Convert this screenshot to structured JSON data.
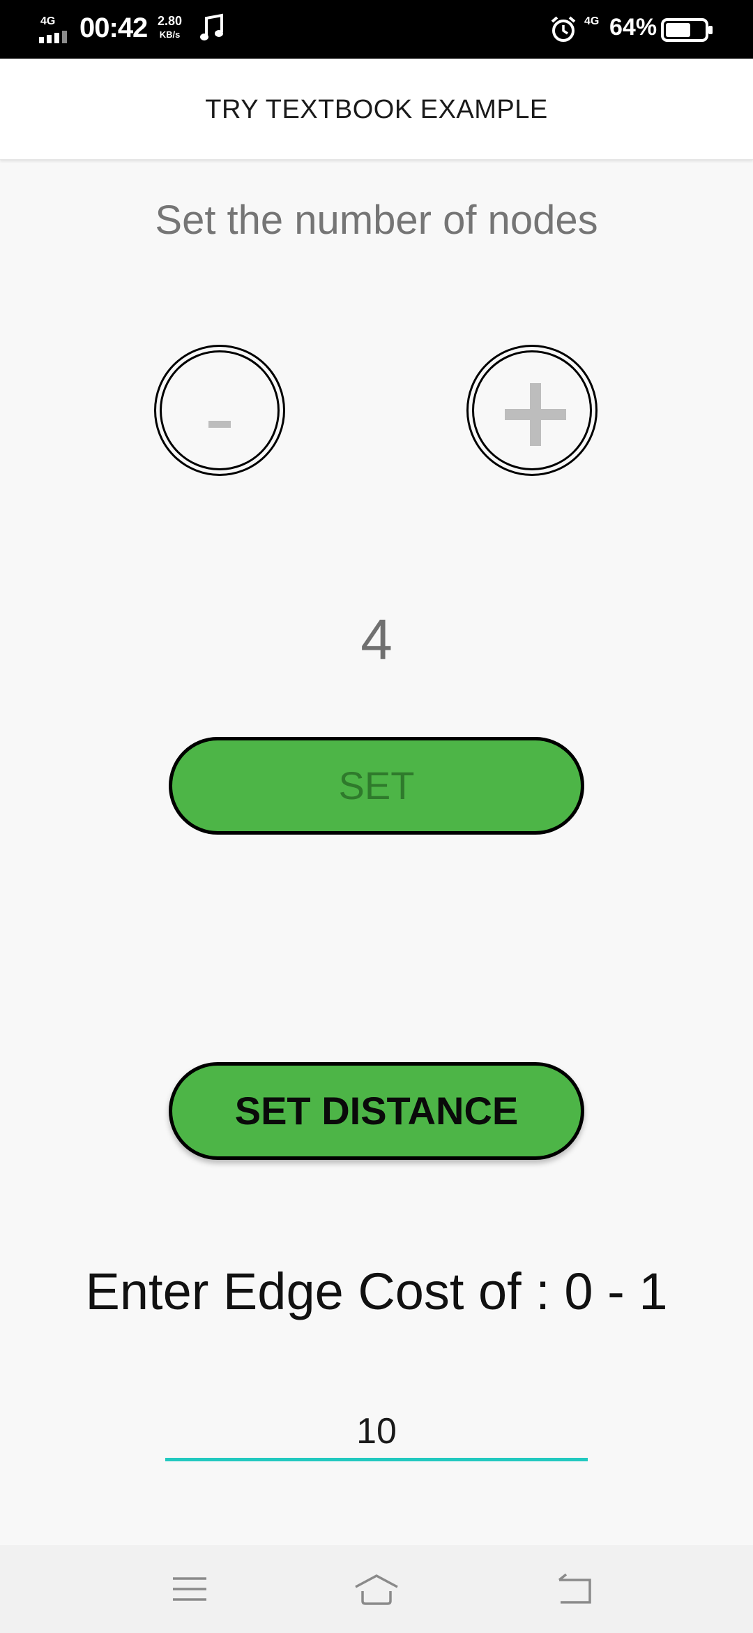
{
  "status_bar": {
    "network_label": "4G",
    "time": "00:42",
    "speed_value": "2.80",
    "speed_unit": "KB/s",
    "secondary_network": "4G",
    "battery_percent": "64%",
    "battery_level": 0.64,
    "icons": [
      "signal-icon",
      "music-note-icon",
      "alarm-icon",
      "battery-icon"
    ]
  },
  "app_bar": {
    "title": "TRY TEXTBOOK EXAMPLE"
  },
  "nodes": {
    "heading": "Set the number of nodes",
    "decrement_label": "-",
    "increment_label": "+",
    "count": "4",
    "set_label": "SET"
  },
  "distance": {
    "set_distance_label": "SET DISTANCE",
    "edge_label": "Enter Edge Cost of : 0 - 1",
    "edge_value": "10"
  },
  "colors": {
    "button_green": "#4db547",
    "input_underline": "#22c9c0",
    "glyph_gray": "#bdbdbd"
  },
  "nav_bar": {
    "icons": [
      "menu-icon",
      "home-icon",
      "back-icon"
    ]
  }
}
